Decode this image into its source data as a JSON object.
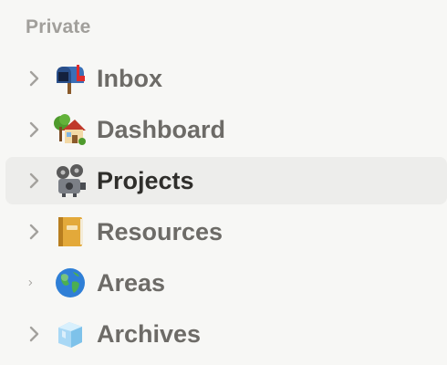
{
  "sidebar": {
    "section_label": "Private",
    "items": [
      {
        "label": "Inbox",
        "icon": "mailbox-icon"
      },
      {
        "label": "Dashboard",
        "icon": "house-icon"
      },
      {
        "label": "Projects",
        "icon": "film-projector-icon",
        "active": true
      },
      {
        "label": "Resources",
        "icon": "notebook-icon"
      },
      {
        "label": "Areas",
        "icon": "globe-icon"
      },
      {
        "label": "Archives",
        "icon": "ice-cube-icon"
      }
    ]
  },
  "colors": {
    "background": "#f7f7f5",
    "active_row": "#ededeb",
    "label": "#6d6b67",
    "label_active": "#2f2e2b",
    "section_label": "#a19f9b"
  }
}
